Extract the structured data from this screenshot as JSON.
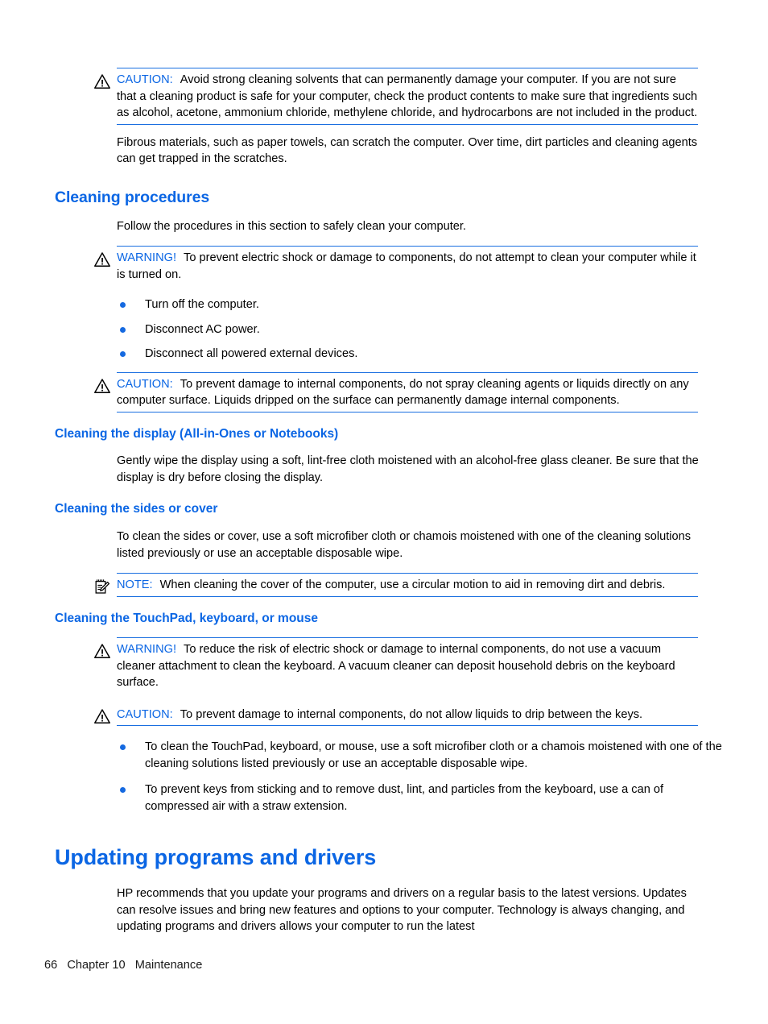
{
  "page": {
    "number": "66",
    "chapter": "Chapter 10",
    "chapter_title": "Maintenance",
    "footer_text": "66   Chapter 10   Maintenance",
    "accent_color": "#0b66e4",
    "rule_color": "#1a6fe0",
    "bullet_color": "#1569e0",
    "text_color": "#000000"
  },
  "labels": {
    "caution": "CAUTION:",
    "warning": "WARNING!",
    "note": "NOTE:"
  },
  "blocks": {
    "caution_solvents": {
      "label": "CAUTION:",
      "icon": "warning-triangle-icon",
      "text": "Avoid strong cleaning solvents that can permanently damage your computer. If you are not sure that a cleaning product is safe for your computer, check the product contents to make sure that ingredients such as alcohol, acetone, ammonium chloride, methylene chloride, and hydrocarbons are not included in the product."
    },
    "fibrous_para": "Fibrous materials, such as paper towels, can scratch the computer. Over time, dirt particles and cleaning agents can get trapped in the scratches.",
    "cleaning_procedures_heading": "Cleaning procedures",
    "cleaning_procedures_para": "Follow the procedures in this section to safely clean your computer.",
    "warning_shock": {
      "label": "WARNING!",
      "icon": "warning-triangle-icon",
      "text": "To prevent electric shock or damage to components, do not attempt to clean your computer while it is turned on."
    },
    "power_steps": [
      "Turn off the computer.",
      "Disconnect AC power.",
      "Disconnect all powered external devices."
    ],
    "caution_spray": {
      "label": "CAUTION:",
      "icon": "warning-triangle-icon",
      "text": "To prevent damage to internal components, do not spray cleaning agents or liquids directly on any computer surface. Liquids dripped on the surface can permanently damage internal components."
    },
    "display_heading": "Cleaning the display (All-in-Ones or Notebooks)",
    "display_para": "Gently wipe the display using a soft, lint-free cloth moistened with an alcohol-free glass cleaner. Be sure that the display is dry before closing the display.",
    "sides_heading": "Cleaning the sides or cover",
    "sides_para": "To clean the sides or cover, use a soft microfiber cloth or chamois moistened with one of the cleaning solutions listed previously or use an acceptable disposable wipe.",
    "note_circular": {
      "label": "NOTE:",
      "icon": "notepad-pencil-icon",
      "text": "When cleaning the cover of the computer, use a circular motion to aid in removing dirt and debris."
    },
    "touchpad_heading": "Cleaning the TouchPad, keyboard, or mouse",
    "warning_vacuum": {
      "label": "WARNING!",
      "icon": "warning-triangle-icon",
      "text": "To reduce the risk of electric shock or damage to internal components, do not use a vacuum cleaner attachment to clean the keyboard. A vacuum cleaner can deposit household debris on the keyboard surface."
    },
    "caution_liquids": {
      "label": "CAUTION:",
      "icon": "warning-triangle-icon",
      "text": "To prevent damage to internal components, do not allow liquids to drip between the keys."
    },
    "touchpad_steps": [
      "To clean the TouchPad, keyboard, or mouse, use a soft microfiber cloth or a chamois moistened with one of the cleaning solutions listed previously or use an acceptable disposable wipe.",
      "To prevent keys from sticking and to remove dust, lint, and particles from the keyboard, use a can of compressed air with a straw extension."
    ],
    "updating_heading": "Updating programs and drivers",
    "updating_para": "HP recommends that you update your programs and drivers on a regular basis to the latest versions. Updates can resolve issues and bring new features and options to your computer. Technology is always changing, and updating programs and drivers allows your computer to run the latest"
  }
}
